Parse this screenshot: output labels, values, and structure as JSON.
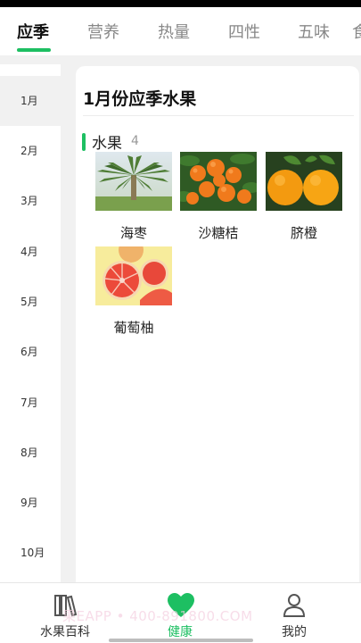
{
  "top_tabs": [
    "应季",
    "营养",
    "热量",
    "四性",
    "五味",
    "食"
  ],
  "months": [
    "1月",
    "2月",
    "3月",
    "4月",
    "5月",
    "6月",
    "7月",
    "8月",
    "9月",
    "10月"
  ],
  "selected_month": "1月",
  "card": {
    "title": "1月份应季水果",
    "section_label": "水果",
    "section_count": "4",
    "fruits": [
      {
        "name": "海枣",
        "icon": "date-palm-photo"
      },
      {
        "name": "沙糖桔",
        "icon": "mandarin-photo"
      },
      {
        "name": "脐橙",
        "icon": "navel-orange-photo"
      },
      {
        "name": "葡萄柚",
        "icon": "grapefruit-photo"
      }
    ]
  },
  "bottom_nav": [
    {
      "label": "水果百科",
      "icon": "books-icon"
    },
    {
      "label": "健康",
      "icon": "heart-icon",
      "active": true
    },
    {
      "label": "我的",
      "icon": "user-icon"
    }
  ],
  "watermark": "果EAPP • 400-891800.COM",
  "colors": {
    "accent": "#1dbf62",
    "background": "#f1f1f1"
  }
}
